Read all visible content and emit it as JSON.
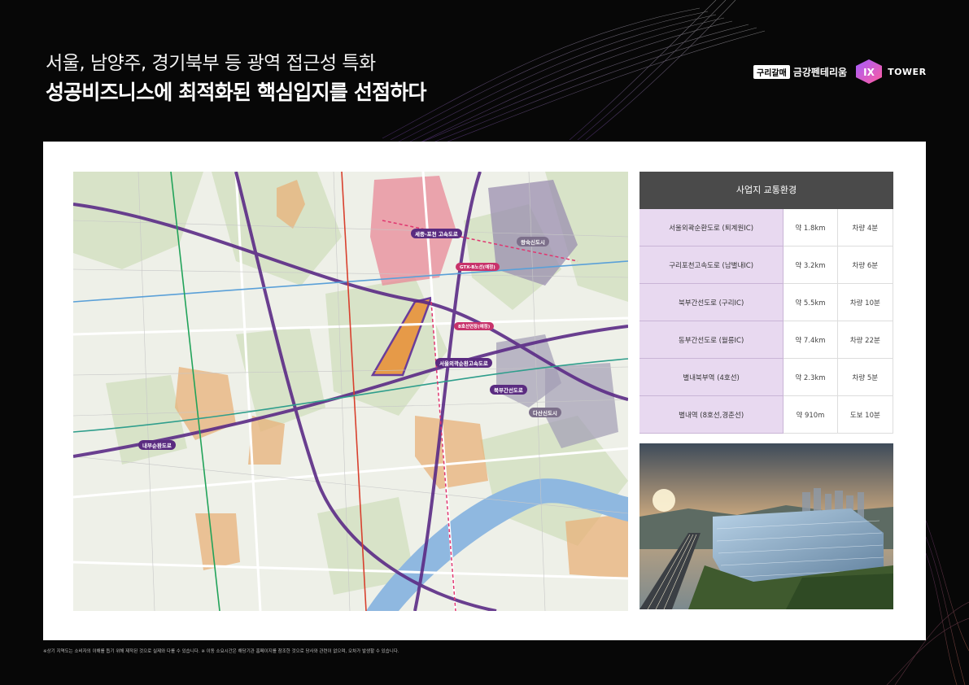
{
  "header": {
    "subtitle": "서울, 남양주, 경기북부 등 광역 접근성 특화",
    "title": "성공비즈니스에 최적화된 핵심입지를 선점하다"
  },
  "brand": {
    "tag": "구리갈매",
    "name": "금강펜테리움",
    "logo_text": "IX",
    "tower": "TOWER"
  },
  "map": {
    "labels": {
      "road_sejong": "세종-포천 고속도로",
      "road_seoul_outer": "서울외곽순환고속도로",
      "road_bukbu": "북부간선도로",
      "road_naebu": "내부순환도로",
      "gtx": "GTX-B노선(예정)",
      "line8": "8호선연장(예정)",
      "dabeol": "다산신도시",
      "wangsuk": "왕숙신도시"
    }
  },
  "table": {
    "header": "사업지 교통환경",
    "rows": [
      {
        "place": "서울외곽순환도로 (퇴계원IC)",
        "distance": "약 1.8km",
        "time": "차량 4분"
      },
      {
        "place": "구리포천고속도로 (남별내IC)",
        "distance": "약 3.2km",
        "time": "차량 6분"
      },
      {
        "place": "북부간선도로 (구리IC)",
        "distance": "약 5.5km",
        "time": "차량 10분"
      },
      {
        "place": "동부간선도로 (월릉IC)",
        "distance": "약 7.4km",
        "time": "차량 22분"
      },
      {
        "place": "별내북부역 (4호선)",
        "distance": "약 2.3km",
        "time": "차량 5분"
      },
      {
        "place": "별내역 (8호선,경춘선)",
        "distance": "약 910m",
        "time": "도보 10분"
      }
    ]
  },
  "footnote": "※상기 지역도는 소비자의 이해를 돕기 위해 제작된 것으로 실제와 다를 수 있습니다.  ※ 이동 소요시간은 해당기관 홈페이지를 참조한 것으로 당사와 관련이 없으며, 오차가 발생할 수 있습니다."
}
